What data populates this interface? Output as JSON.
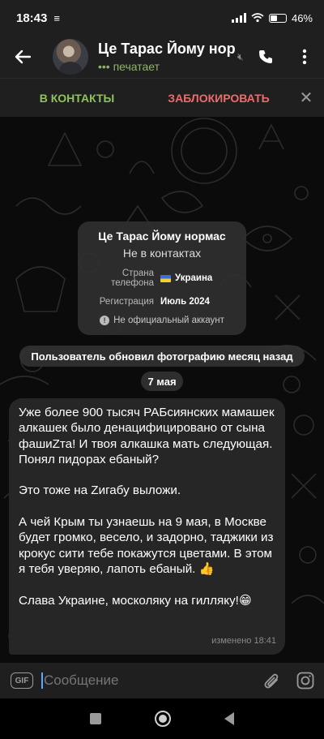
{
  "status_bar": {
    "time": "18:43",
    "battery": "46%",
    "battery_level": 0.46
  },
  "header": {
    "title": "Це Тарас Йому нормас",
    "status": "••• печатает",
    "icons": [
      "back-arrow-icon",
      "mute-icon",
      "phone-icon",
      "more-vertical-icon"
    ]
  },
  "action_bar": {
    "add_contact": "В КОНТАКТЫ",
    "block": "ЗАБЛОКИРОВАТЬ"
  },
  "info_card": {
    "name": "Це Тарас Йому нормас",
    "subtitle": "Не в контактах",
    "rows": [
      {
        "key": "Страна телефона",
        "value": "Украина"
      },
      {
        "key": "Регистрация",
        "value": "Июль 2024"
      }
    ],
    "note": "Не официальный аккаунт"
  },
  "service_message": "Пользователь обновил фотографию месяц назад",
  "date_separator": "7 мая",
  "message": {
    "paragraphs": [
      "Уже более 900 тысяч РАБсиянских мамашек алкашек было денацифицировано от сына фашиZта! И твоя алкашка мать следующая. Понял пидорах ебаный?",
      "Это тоже на Zигабу выложи.",
      "А чей Крым ты узнаешь на 9 мая, в Москве будет громко, весело, и задорно, таджики из крокус сити тебе покажутся цветами. В этом я тебя уверяю, лапоть ебаный. 👍",
      "Слава Украине, москоляку на гилляку!😁"
    ],
    "meta": "изменено 18:41"
  },
  "input": {
    "placeholder": "Сообщение",
    "gif_label": "GIF"
  },
  "colors": {
    "accent_green": "#8fc35a",
    "block_red": "#ef6b6b",
    "bubble": "#262626",
    "header": "#1f1f1f"
  }
}
